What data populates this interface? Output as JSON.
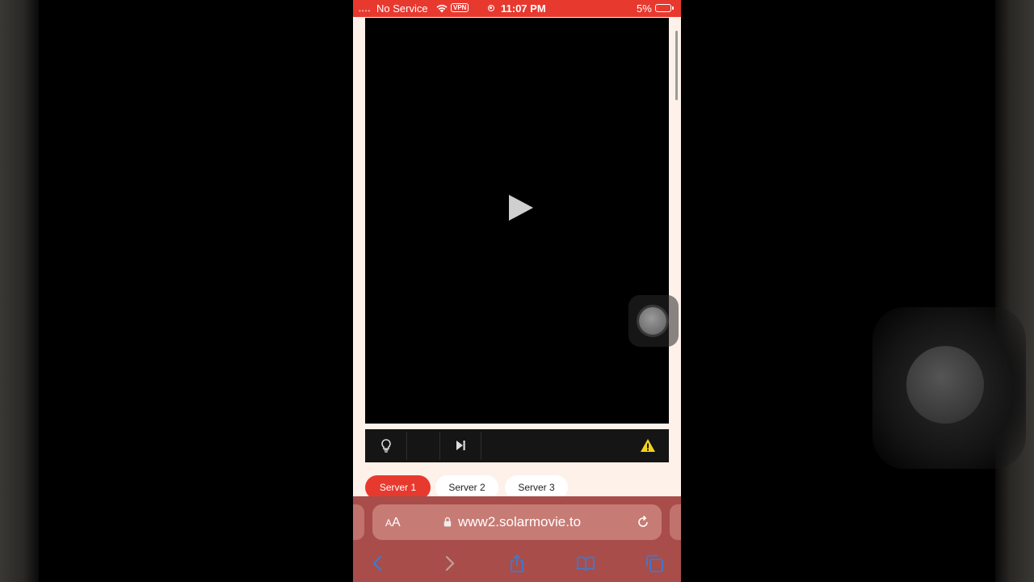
{
  "status_bar": {
    "carrier": "No Service",
    "vpn_badge": "VPN",
    "time": "11:07 PM",
    "battery": "5%",
    "battery_level": 0.05
  },
  "video_player": {
    "play_icon": "play-icon",
    "controls": {
      "light_icon": "lightbulb-icon",
      "next_icon": "skip-next-icon",
      "report_icon": "warning-icon"
    }
  },
  "servers": [
    {
      "label": "Server 1",
      "active": true
    },
    {
      "label": "Server 2",
      "active": false
    },
    {
      "label": "Server 3",
      "active": false
    }
  ],
  "browser": {
    "text_size_label_small": "A",
    "text_size_label_large": "A",
    "url": "www2.solarmovie.to",
    "toolbar": [
      "back-icon",
      "forward-icon",
      "share-icon",
      "bookmarks-icon",
      "tabs-icon"
    ]
  },
  "colors": {
    "accent": "#e8392f",
    "page_bg": "#fdf1ea",
    "browser_bar": "#a84d4a",
    "toolbar_icon": "#3a7bd5",
    "warning": "#f2d21b"
  }
}
